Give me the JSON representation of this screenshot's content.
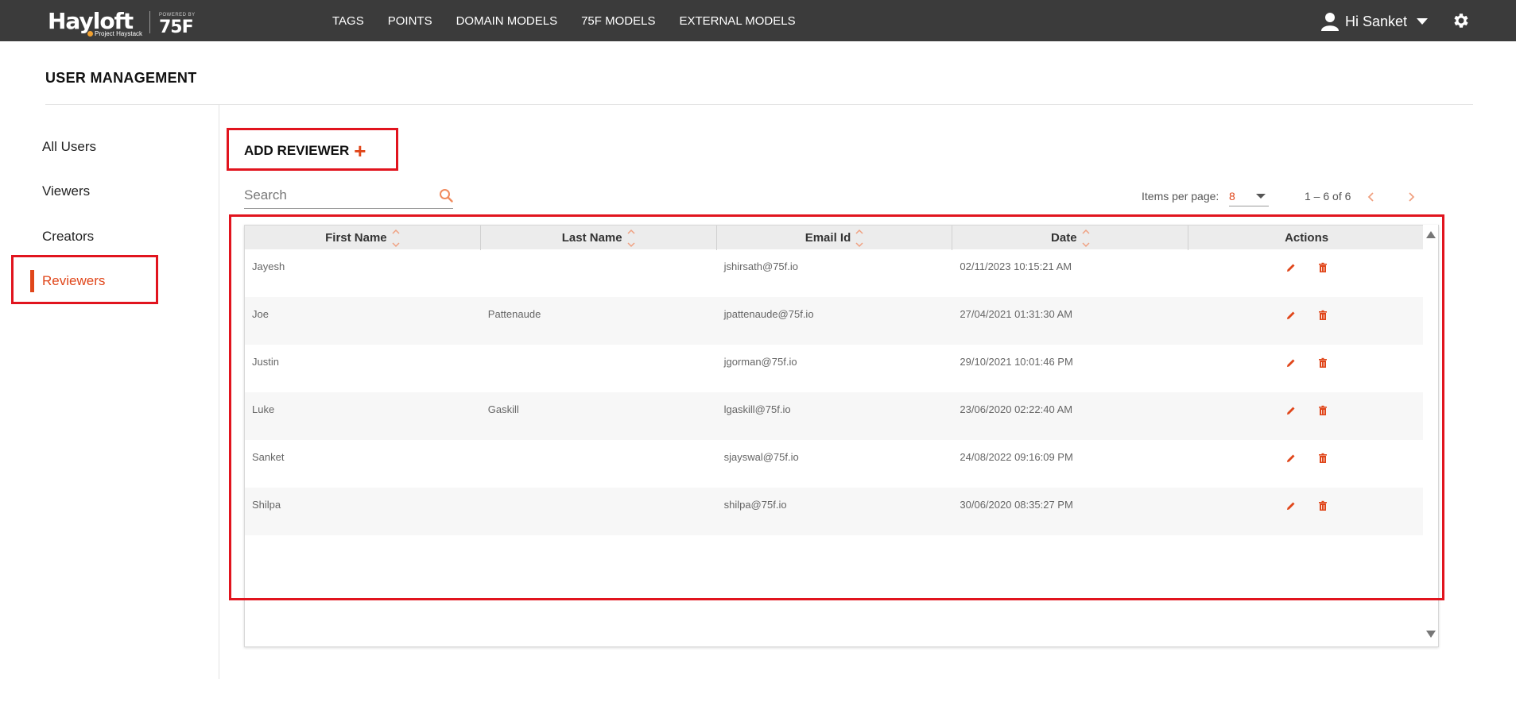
{
  "brand": {
    "name": "Hayloft",
    "sub": "Project Haystack",
    "powered": "POWERED BY",
    "partner": "75F"
  },
  "nav": [
    {
      "label": "TAGS"
    },
    {
      "label": "POINTS"
    },
    {
      "label": "DOMAIN MODELS"
    },
    {
      "label": "75F MODELS"
    },
    {
      "label": "EXTERNAL MODELS"
    }
  ],
  "user": {
    "greeting": "Hi Sanket"
  },
  "page": {
    "title": "USER MANAGEMENT"
  },
  "sidebar": {
    "items": [
      {
        "label": "All Users"
      },
      {
        "label": "Viewers"
      },
      {
        "label": "Creators"
      },
      {
        "label": "Reviewers"
      }
    ],
    "active": "Reviewers"
  },
  "toolbar": {
    "add_label": "ADD REVIEWER",
    "plus": "+",
    "search_placeholder": "Search",
    "items_per_page_label": "Items per page:",
    "items_per_page_value": "8",
    "range": "1 – 6 of 6"
  },
  "table": {
    "columns": [
      "First Name",
      "Last Name",
      "Email Id",
      "Date",
      "Actions"
    ],
    "rows": [
      {
        "first": "Jayesh",
        "last": "",
        "email": "jshirsath@75f.io",
        "date": "02/11/2023 10:15:21 AM"
      },
      {
        "first": "Joe",
        "last": "Pattenaude",
        "email": "jpattenaude@75f.io",
        "date": "27/04/2021 01:31:30 AM"
      },
      {
        "first": "Justin",
        "last": "",
        "email": "jgorman@75f.io",
        "date": "29/10/2021 10:01:46 PM"
      },
      {
        "first": "Luke",
        "last": "Gaskill",
        "email": "lgaskill@75f.io",
        "date": "23/06/2020 02:22:40 AM"
      },
      {
        "first": "Sanket",
        "last": "",
        "email": "sjayswal@75f.io",
        "date": "24/08/2022 09:16:09 PM"
      },
      {
        "first": "Shilpa",
        "last": "",
        "email": "shilpa@75f.io",
        "date": "30/06/2020 08:35:27 PM"
      }
    ]
  },
  "colors": {
    "accent": "#e0461a",
    "topbar": "#3b3b3b",
    "highlight": "#e1141e"
  }
}
